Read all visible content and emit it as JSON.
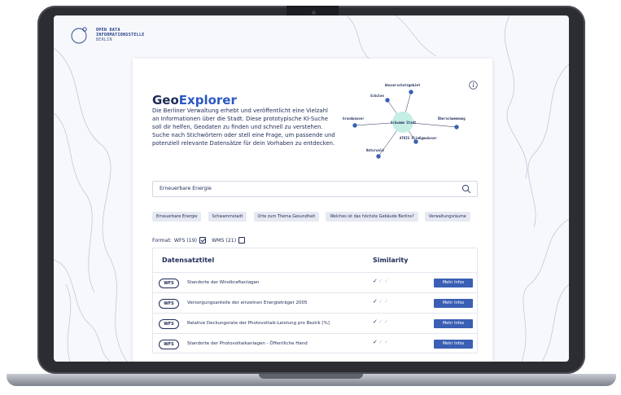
{
  "logo": {
    "line1": "OPEN DATA",
    "line2": "INFORMATIONSSTELLE",
    "line3": "BERLIN"
  },
  "header": {
    "title_prefix": "Geo",
    "title_accent": "Explorer",
    "description": "Die Berliner Verwaltung erhebt und veröffentlicht eine Vielzahl an Informationen über die Stadt. Diese prototypische KI-Suche soll dir helfen, Geodaten zu finden und schnell zu verstehen. Suche nach Stichwörtern oder stell eine Frage, um passende und potenziell relevante Datensätze für dein Vorhaben zu entdecken."
  },
  "graph": {
    "center": "Schwamm Stadt",
    "nodes": [
      "Wasserschutzgebiet",
      "Schulen",
      "Grundwasser",
      "Überschwemmung",
      "ATKIS Fließgewässer",
      "Naturwald"
    ]
  },
  "search": {
    "value": "Erneuerbare Energie"
  },
  "chips": [
    "Erneuerbare Energie",
    "Schwammstadt",
    "Orte zum Thema Gesundheit",
    "Welches ist das höchste Gebäude Berlins?",
    "Verwaltungsräume"
  ],
  "format": {
    "label": "Format:",
    "wfs_label": "WFS (19)",
    "wfs_checked": true,
    "wms_label": "WMS (21)",
    "wms_checked": false
  },
  "table": {
    "col_title": "Datensatztitel",
    "col_similarity": "Similarity",
    "rows": [
      {
        "type": "WFS",
        "title": "Standorte der Windkraftanlagen",
        "similarity": 1,
        "button": "Mehr Infos"
      },
      {
        "type": "WFS",
        "title": "Versorgungsanteile der einzelnen Energieträger 2005",
        "similarity": 1,
        "button": "Mehr Infos"
      },
      {
        "type": "WFS",
        "title": "Relative Deckungsrate der Photovoltaik-Leistung pro Bezirk [%]",
        "similarity": 1,
        "button": "Mehr Infos"
      },
      {
        "type": "WFS",
        "title": "Standorte der Photovoltaikanlagen - Öffentliche Hand",
        "similarity": 1,
        "button": "Mehr Infos"
      }
    ]
  },
  "colors": {
    "navy": "#1e2a57",
    "accent": "#2b59c3",
    "button": "#3a5fb4",
    "bubble": "#c5eee4"
  }
}
